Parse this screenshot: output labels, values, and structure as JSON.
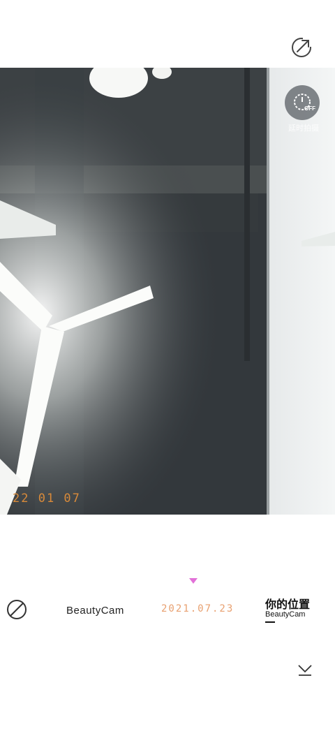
{
  "toolbar": {
    "share_icon": "share-arrow-icon"
  },
  "photo": {
    "date_stamp": "22 01 07",
    "timer": {
      "icon": "timer-off-icon",
      "badge": "OFF",
      "label": "延时拍摄"
    }
  },
  "filters": {
    "selected_marker_color": "#e271d8",
    "items": [
      {
        "id": "none",
        "icon": "no-filter-icon"
      },
      {
        "id": "beautycam",
        "label": "BeautyCam"
      },
      {
        "id": "date",
        "label": "2021.07.23"
      },
      {
        "id": "location",
        "title": "你的位置",
        "subtitle": "BeautyCam"
      }
    ]
  },
  "bottom": {
    "collapse_icon": "chevron-down-icon"
  }
}
